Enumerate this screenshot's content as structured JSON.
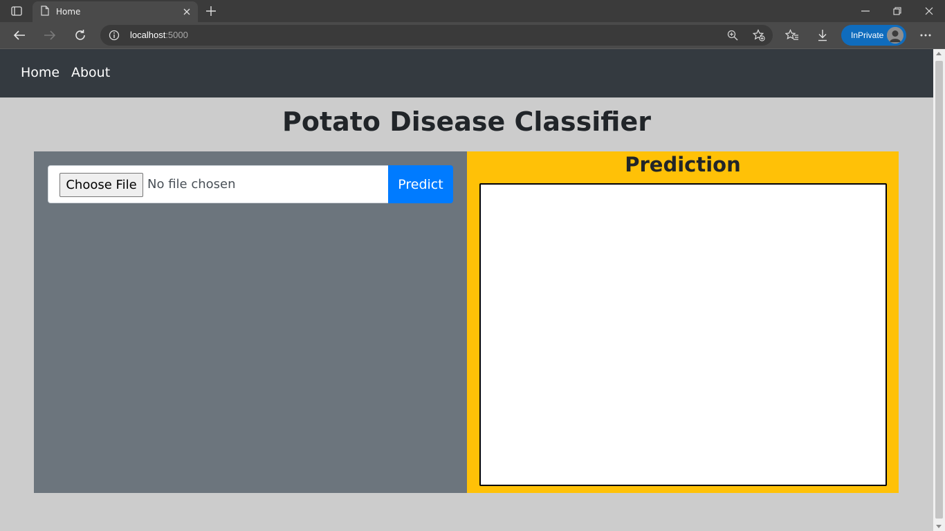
{
  "browser": {
    "tab_title": "Home",
    "address_host": "localhost",
    "address_port": ":5000",
    "inprivate_label": "InPrivate"
  },
  "icons": {
    "tab_actions": "tab-actions-icon",
    "page": "page-icon",
    "close": "close-icon",
    "new_tab": "plus-icon",
    "minimize": "minimize-icon",
    "restore": "restore-icon",
    "window_close": "close-icon",
    "back": "back-arrow-icon",
    "forward": "forward-arrow-icon",
    "refresh": "refresh-icon",
    "site_info": "info-icon",
    "zoom": "zoom-icon",
    "add_favorite": "star-add-icon",
    "favorites": "favorites-icon",
    "downloads": "download-icon",
    "more": "more-icon"
  },
  "navbar": {
    "home_label": "Home",
    "about_label": "About"
  },
  "page": {
    "title": "Potato Disease Classifier"
  },
  "upload": {
    "choose_label": "Choose File",
    "file_status": "No file chosen",
    "predict_label": "Predict"
  },
  "prediction": {
    "title": "Prediction"
  },
  "colors": {
    "navbar": "#343a40",
    "page_bg": "#cccccc",
    "left_panel": "#6c757d",
    "right_panel": "#ffc107",
    "predict_button": "#007bff",
    "inprivate": "#0f6cbd"
  }
}
